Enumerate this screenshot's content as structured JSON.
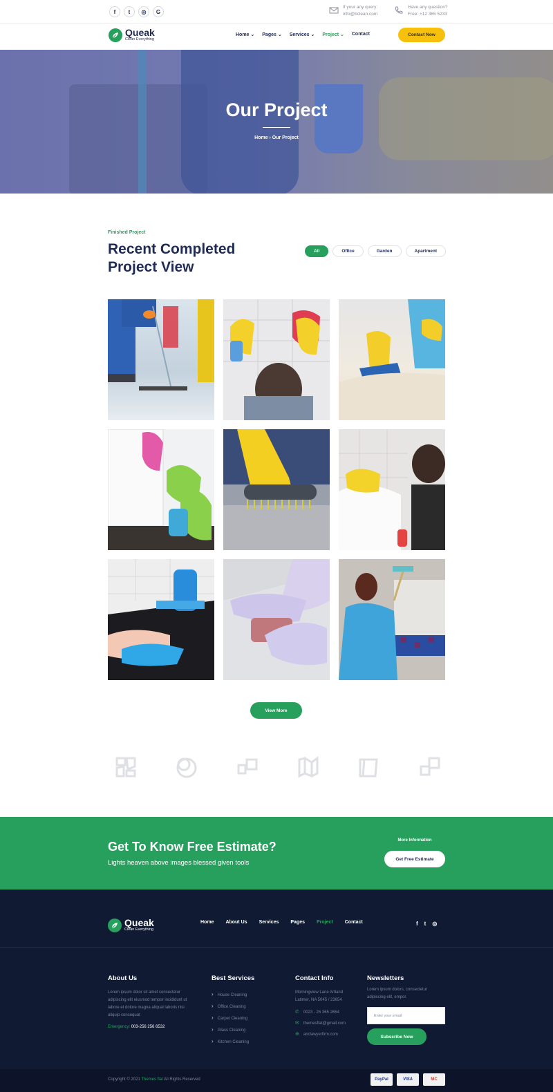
{
  "topbar": {
    "socials": [
      {
        "icon": "facebook-icon",
        "glyph": "f"
      },
      {
        "icon": "twitter-icon",
        "glyph": "t"
      },
      {
        "icon": "instagram-icon",
        "glyph": "◎"
      },
      {
        "icon": "google-icon",
        "glyph": "G"
      }
    ],
    "query_label": "If your any query:",
    "query_value": "info@bclean.com",
    "question_label": "Have any question?",
    "question_value": "Free: +12 365 5233"
  },
  "header": {
    "logo_name": "Queak",
    "logo_tagline": "Clean Everything",
    "nav": [
      {
        "label": "Home ⌄"
      },
      {
        "label": "Pages ⌄"
      },
      {
        "label": "Services ⌄"
      },
      {
        "label": "Project ⌄",
        "active": true
      },
      {
        "label": "Contact"
      }
    ],
    "contact_button": "Contact Now"
  },
  "hero": {
    "title": "Our Project",
    "breadcrumb": "Home  ›  Our Project"
  },
  "projects": {
    "subtitle": "Finished Project",
    "title": "Recent Completed Project View",
    "filters": [
      {
        "label": "All",
        "active": true
      },
      {
        "label": "Office"
      },
      {
        "label": "Garden"
      },
      {
        "label": "Apartment"
      }
    ],
    "view_more": "View More"
  },
  "cta": {
    "title": "Get To Know Free Estimate?",
    "subtitle": "Lights heaven above images blessed given tools",
    "more_label": "More Information",
    "button": "Get Free Estimate"
  },
  "footer": {
    "logo_name": "Queak",
    "logo_tagline": "Clean Everything",
    "nav": [
      {
        "label": "Home"
      },
      {
        "label": "About Us"
      },
      {
        "label": "Services"
      },
      {
        "label": "Pages"
      },
      {
        "label": "Project",
        "active": true
      },
      {
        "label": "Contact"
      }
    ],
    "about": {
      "heading": "About Us",
      "text": "Lorem ipsum dolor sit amet consectetur adipiscing elit eiusmod tempor incididunt ut labore et dolore magna aliqual laboris nisi aliquip consequat",
      "emergency_label": "Emergency:",
      "emergency_value": "003-256 256 6532"
    },
    "services": {
      "heading": "Best Services",
      "items": [
        "House Cleaning",
        "Office Cleaning",
        "Carpet Cleaning",
        "Glass Cleaning",
        "Kitchen Cleaning"
      ]
    },
    "contact": {
      "heading": "Contact Info",
      "address": "Morningview Lane Artland Latimer, NA 5045 / 23654",
      "phone": "0023 - 25 365 2654",
      "email": "themesflat@gmail.com",
      "web": "anclawyerfirm.com"
    },
    "newsletter": {
      "heading": "Newsletters",
      "text": "Lorem ipsum dolors, consectetur adipiscing elit, empor.",
      "placeholder": "Enter your email",
      "button": "Subscribe Now"
    },
    "copyright_prefix": "Copyright © 2021",
    "copyright_brand": "Themes flat",
    "copyright_suffix": "All Rights Reserved",
    "payments": [
      "PayPal",
      "VISA",
      "MC"
    ]
  },
  "colors": {
    "brand_green": "#27a05e",
    "navy": "#1f2a55",
    "accent_yellow": "#f6c00d",
    "footer_bg": "#111a33"
  }
}
